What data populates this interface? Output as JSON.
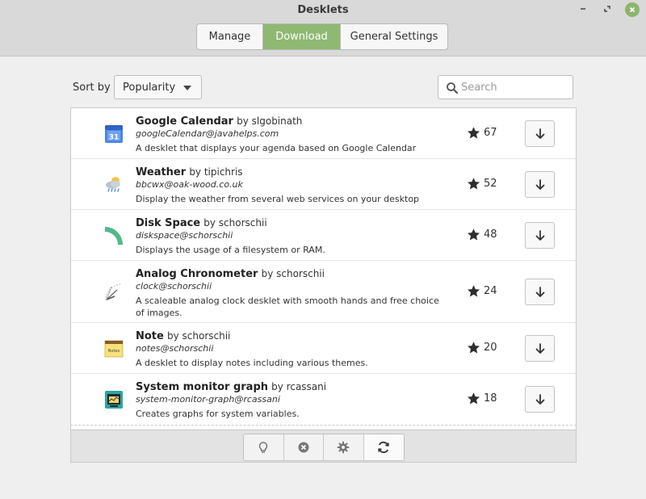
{
  "window": {
    "title": "Desklets"
  },
  "tabs": [
    {
      "label": "Manage",
      "active": false
    },
    {
      "label": "Download",
      "active": true
    },
    {
      "label": "General Settings",
      "active": false
    }
  ],
  "sort": {
    "label": "Sort by",
    "value": "Popularity"
  },
  "search": {
    "placeholder": "Search",
    "value": ""
  },
  "desklets": [
    {
      "name": "Google Calendar",
      "by": "by slgobinath",
      "uuid": "googleCalendar@javahelps.com",
      "description": "A desklet that displays your agenda based on Google Calendar",
      "score": "67",
      "icon": "calendar-icon"
    },
    {
      "name": "Weather",
      "by": "by tipichris",
      "uuid": "bbcwx@oak-wood.co.uk",
      "description": "Display the weather from several web services on your desktop",
      "score": "52",
      "icon": "weather-icon"
    },
    {
      "name": "Disk Space",
      "by": "by schorschii",
      "uuid": "diskspace@schorschii",
      "description": "Displays the usage of a filesystem or RAM.",
      "score": "48",
      "icon": "disk-space-icon"
    },
    {
      "name": "Analog Chronometer",
      "by": "by schorschii",
      "uuid": "clock@schorschii",
      "description": "A scaleable analog clock desklet with smooth hands and free choice of images.",
      "score": "24",
      "icon": "clock-icon"
    },
    {
      "name": "Note",
      "by": "by schorschii",
      "uuid": "notes@schorschii",
      "description": "A desklet to display notes including various themes.",
      "score": "20",
      "icon": "note-icon"
    },
    {
      "name": "System monitor graph",
      "by": "by rcassani",
      "uuid": "system-monitor-graph@rcassani",
      "description": "Creates graphs for system variables.",
      "score": "18",
      "icon": "monitor-icon"
    }
  ],
  "calendar_icon_text": "31",
  "note_icon_text": "Notes",
  "colors": {
    "accent": "#8fb872",
    "close": "#8cb56b"
  }
}
